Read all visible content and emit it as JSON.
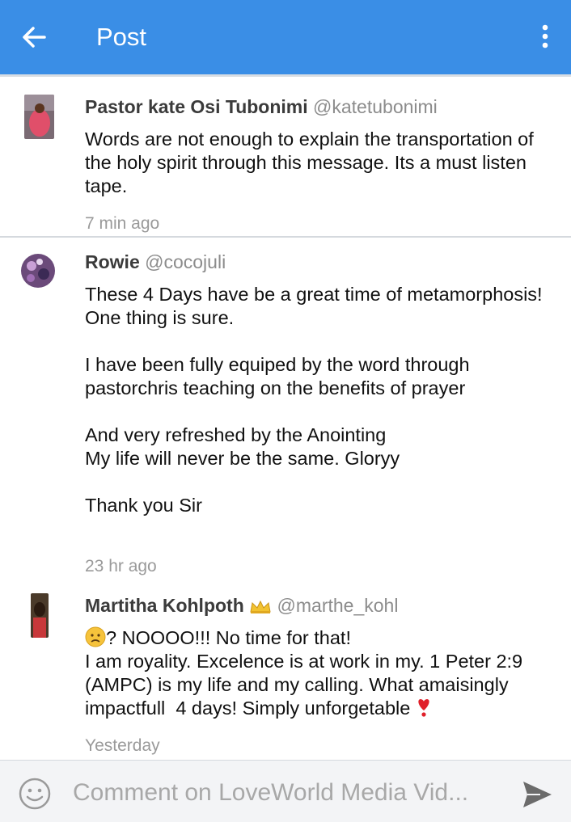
{
  "appbar": {
    "title": "Post",
    "background": "#3a8ee6"
  },
  "comments": [
    {
      "name": "Pastor kate  Osi Tubonimi",
      "handle": "@katetubonimi",
      "body": "Words are not enough to explain the transportation of the holy spirit through this message. Its a must listen tape.",
      "time": "7 min ago"
    },
    {
      "name": "Rowie",
      "handle": "@cocojuli",
      "body": "These 4 Days have be a great time of metamorphosis! One thing is sure.\n\nI have been fully equiped by the word through pastorchris teaching on the benefits of prayer\n\nAnd very refreshed by the Anointing\nMy life will never be the same. Gloryy\n\nThank you Sir",
      "time": "23 hr ago"
    },
    {
      "name": "Martitha Kohlpoth",
      "name_badge": "crown-icon",
      "handle": "@marthe_kohl",
      "body_line1": "? NOOOO!!! No time for that!",
      "body_rest": "I am royality. Excelence is at work in my. 1 Peter 2:9 (AMPC) is my life and my calling. What amaisingly impactfull  4 days! Simply unforgetable",
      "body_lead_icon": "frowning-face-icon",
      "body_trail_icon": "heavy-exclamation-heart-icon",
      "time": "Yesterday"
    }
  ],
  "composer": {
    "placeholder": "Comment on LoveWorld Media Vid...",
    "emoji_icon": "smiley-icon",
    "send_icon": "send-icon"
  }
}
